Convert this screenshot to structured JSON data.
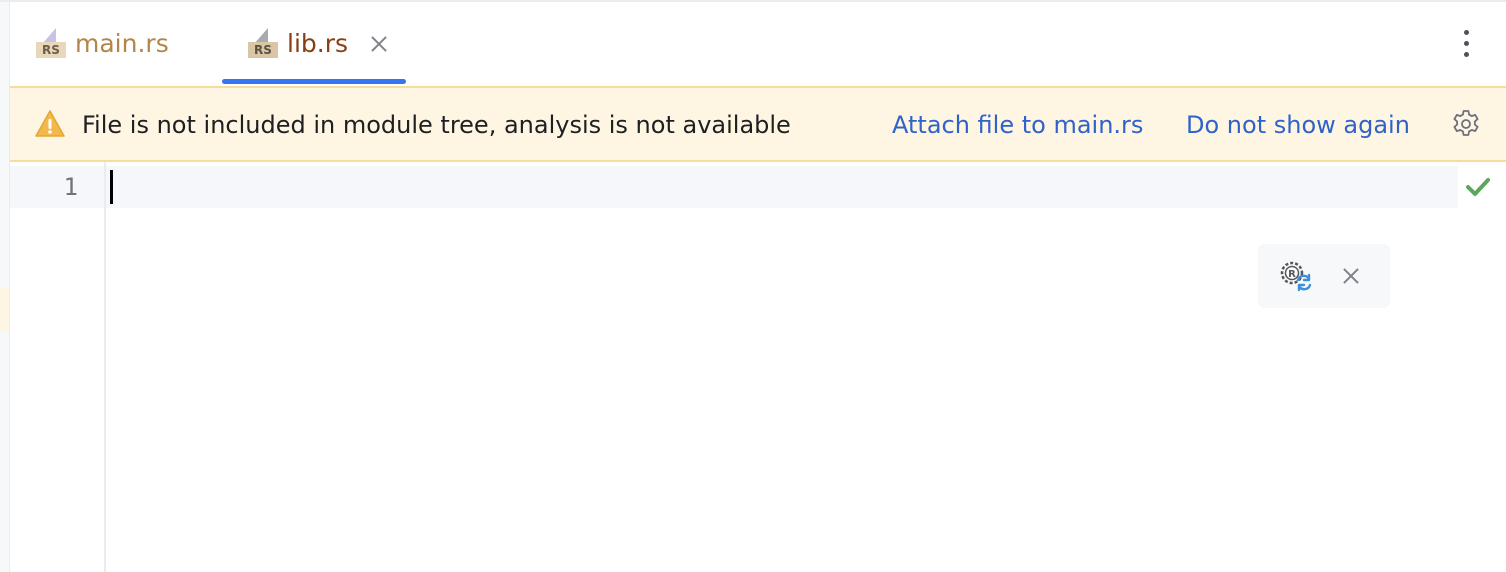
{
  "tabs": [
    {
      "label": "main.rs",
      "icon": "rust-file-icon",
      "icon_badge": "RS",
      "active": false
    },
    {
      "label": "lib.rs",
      "icon": "rust-file-icon",
      "icon_badge": "RS",
      "active": true
    }
  ],
  "tab_bar": {
    "more_icon": "vertical-ellipsis-icon",
    "close_icon": "close-icon",
    "active_underline_color": "#3574f0"
  },
  "banner": {
    "icon": "warning-icon",
    "message": "File is not included in module tree, analysis is not available",
    "attach_link": "Attach file to main.rs",
    "dont_show_link": "Do not show again",
    "settings_icon": "gear-icon",
    "background_color": "#fef6e2",
    "link_color": "#2f63c9"
  },
  "editor": {
    "line_numbers": [
      "1"
    ],
    "content": "",
    "status_icon": "checkmark-icon",
    "status_color": "#5ca75b"
  },
  "floating_toolbar": {
    "reload_icon": "rust-reload-icon",
    "close_icon": "close-icon"
  }
}
